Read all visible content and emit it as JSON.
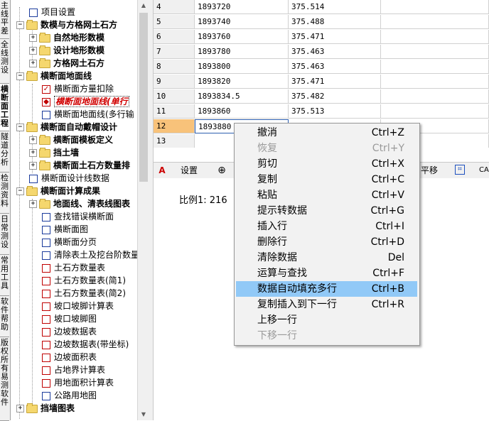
{
  "side_tabs": [
    "主线平差",
    "全线测设",
    "横断面工程",
    "隧道分析",
    "检测资料",
    "日常测设",
    "常用工具",
    "软件帮助",
    "版权所有 易测软件"
  ],
  "tree": {
    "items": [
      {
        "label": "项目设置",
        "kind": "checkbox"
      },
      {
        "label": "数模与方格网土石方",
        "kind": "folder-open"
      },
      {
        "label": "自然地形数模",
        "kind": "folder"
      },
      {
        "label": "设计地形数模",
        "kind": "folder"
      },
      {
        "label": "方格网土石方",
        "kind": "folder"
      },
      {
        "label": "横断面地面线",
        "kind": "folder-open"
      },
      {
        "label": "横断面方量扣除",
        "kind": "checkbox-checked"
      },
      {
        "label": "横断面地面线(单行",
        "kind": "checkbox-red"
      },
      {
        "label": "横断面地面线(多行输",
        "kind": "checkbox"
      },
      {
        "label": "横断面自动戴帽设计",
        "kind": "folder-open"
      },
      {
        "label": "横断面模板定义",
        "kind": "folder"
      },
      {
        "label": "挡土墙",
        "kind": "folder"
      },
      {
        "label": "横断面土石方数量排",
        "kind": "folder"
      },
      {
        "label": "横断面设计线数据",
        "kind": "checkbox"
      },
      {
        "label": "横断面计算成果",
        "kind": "folder-open"
      },
      {
        "label": "地面线、清表线图表",
        "kind": "folder"
      },
      {
        "label": "查找错误横断面",
        "kind": "checkbox"
      },
      {
        "label": "横断面图",
        "kind": "checkbox"
      },
      {
        "label": "横断面分页",
        "kind": "checkbox"
      },
      {
        "label": "清除表土及挖台阶数量",
        "kind": "checkbox"
      },
      {
        "label": "土石方数量表",
        "kind": "checkbox"
      },
      {
        "label": "土石方数量表(简1)",
        "kind": "checkbox"
      },
      {
        "label": "土石方数量表(简2)",
        "kind": "checkbox"
      },
      {
        "label": "坡口坡脚计算表",
        "kind": "checkbox"
      },
      {
        "label": "坡口坡脚图",
        "kind": "checkbox"
      },
      {
        "label": "边坡数据表",
        "kind": "checkbox"
      },
      {
        "label": "边坡数据表(带坐标)",
        "kind": "checkbox"
      },
      {
        "label": "边坡面积表",
        "kind": "checkbox"
      },
      {
        "label": "占地界计算表",
        "kind": "checkbox"
      },
      {
        "label": "用地面积计算表",
        "kind": "checkbox"
      },
      {
        "label": "公路用地图",
        "kind": "checkbox"
      },
      {
        "label": "挡墙图表",
        "kind": "folder"
      }
    ]
  },
  "grid": {
    "rows": [
      {
        "n": "4",
        "a": "1893720",
        "b": "375.514"
      },
      {
        "n": "5",
        "a": "1893740",
        "b": "375.488"
      },
      {
        "n": "6",
        "a": "1893760",
        "b": "375.471"
      },
      {
        "n": "7",
        "a": "1893780",
        "b": "375.463"
      },
      {
        "n": "8",
        "a": "1893800",
        "b": "375.463"
      },
      {
        "n": "9",
        "a": "1893820",
        "b": "375.471"
      },
      {
        "n": "10",
        "a": "1893834.5",
        "b": "375.482"
      },
      {
        "n": "11",
        "a": "1893860",
        "b": "375.513"
      },
      {
        "n": "12",
        "a": "1893880",
        "b": ""
      },
      {
        "n": "13",
        "a": "",
        "b": ""
      }
    ]
  },
  "toolbar": {
    "settings": "设置",
    "pan": "平移",
    "cad": "CA"
  },
  "drawing": {
    "scale": "比例1: 216"
  },
  "menu": {
    "items": [
      {
        "label": "撤消",
        "shortcut": "Ctrl+Z",
        "disabled": false
      },
      {
        "label": "恢复",
        "shortcut": "Ctrl+Y",
        "disabled": true
      },
      {
        "label": "剪切",
        "shortcut": "Ctrl+X",
        "disabled": false
      },
      {
        "label": "复制",
        "shortcut": "Ctrl+C",
        "disabled": false
      },
      {
        "label": "粘贴",
        "shortcut": "Ctrl+V",
        "disabled": false
      },
      {
        "label": "提示转数据",
        "shortcut": "Ctrl+G",
        "disabled": false
      },
      {
        "label": "插入行",
        "shortcut": "Ctrl+I",
        "disabled": false
      },
      {
        "label": "删除行",
        "shortcut": "Ctrl+D",
        "disabled": false
      },
      {
        "label": "清除数据",
        "shortcut": "Del",
        "disabled": false
      },
      {
        "label": "运算与查找",
        "shortcut": "Ctrl+F",
        "disabled": false
      },
      {
        "label": "数据自动填充多行",
        "shortcut": "Ctrl+B",
        "disabled": false,
        "highlighted": true
      },
      {
        "label": "复制插入到下一行",
        "shortcut": "Ctrl+R",
        "disabled": false
      },
      {
        "label": "上移一行",
        "shortcut": "",
        "disabled": false
      },
      {
        "label": "下移一行",
        "shortcut": "",
        "disabled": true
      }
    ]
  },
  "colors": {
    "highlight": "#91c9f7",
    "selected_row": "#f8c27a",
    "red_item": "#d00000"
  }
}
